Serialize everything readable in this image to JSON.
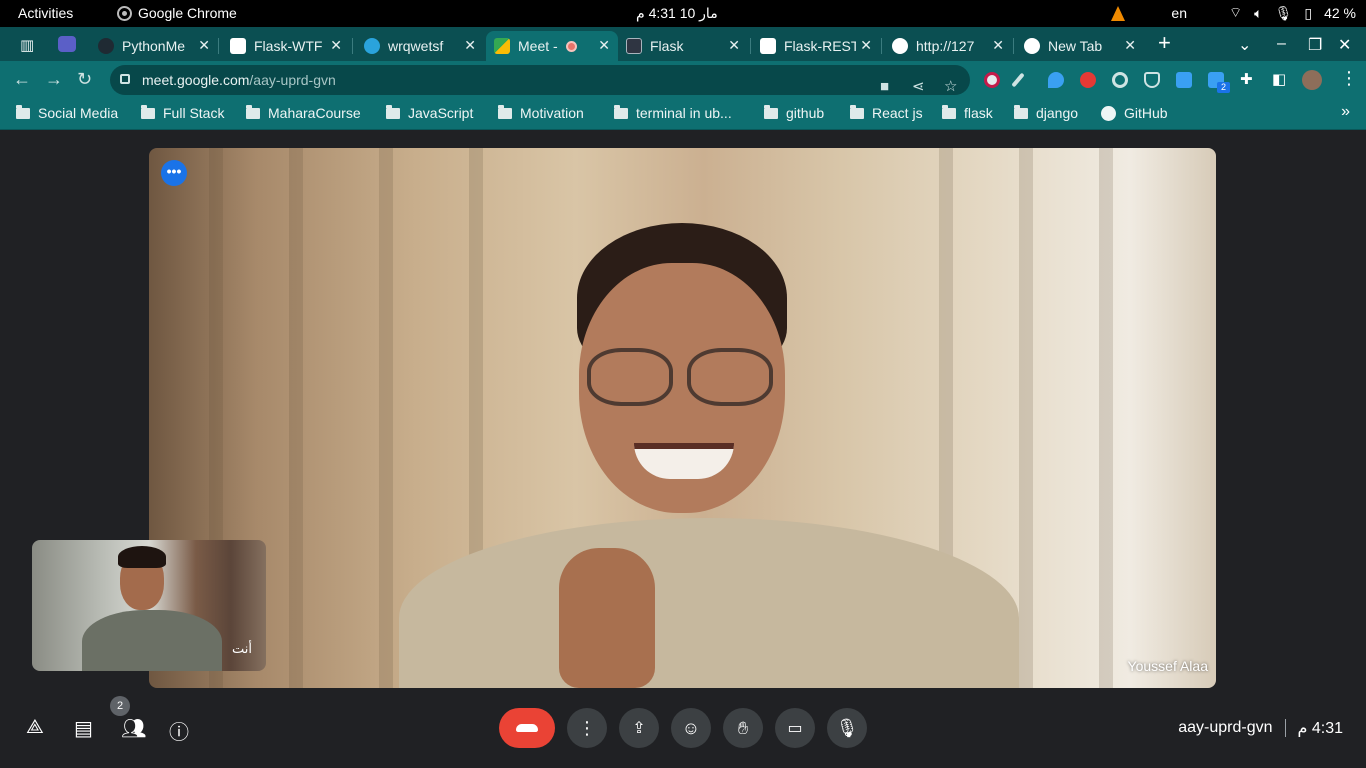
{
  "gnome": {
    "activities": "Activities",
    "app_name": "Google Chrome",
    "clock": "مار 10  4:31 م",
    "lang": "en",
    "battery": "42 %"
  },
  "tabs": [
    {
      "title": "PythonMe",
      "favicon_color": "#1f2a33"
    },
    {
      "title": "Flask-WTF",
      "favicon_color": "#ffffff"
    },
    {
      "title": "wrqwetsf",
      "favicon_color": "#2aa3dc"
    },
    {
      "title": "Meet -",
      "favicon_color": "#34a853",
      "active": true
    },
    {
      "title": "Flask",
      "favicon_color": "#2f3542"
    },
    {
      "title": "Flask-REST",
      "favicon_color": "#ffffff"
    },
    {
      "title": "http://127",
      "favicon_color": "#ffffff"
    },
    {
      "title": "New Tab",
      "favicon_color": "#ffffff"
    }
  ],
  "address_bar": {
    "host": "meet.google.com",
    "path": "/aay-uprd-gvn"
  },
  "bookmarks": [
    {
      "label": "Social Media"
    },
    {
      "label": "Full Stack"
    },
    {
      "label": "MaharaCourse"
    },
    {
      "label": "JavaScript"
    },
    {
      "label": "Motivation"
    },
    {
      "label": "terminal in ub..."
    },
    {
      "label": "github"
    },
    {
      "label": "React js"
    },
    {
      "label": "flask"
    },
    {
      "label": "django"
    },
    {
      "label": "GitHub"
    }
  ],
  "meet": {
    "participant_name": "Youssef Alaa",
    "self_label": "أنت",
    "people_count": "2",
    "meeting_code": "aay-uprd-gvn",
    "time": "4:31 م",
    "extension_badge": "2"
  },
  "colors": {
    "end_call": "#ea4335",
    "accent": "#1a73e8",
    "chrome_frame": "#0e6f71"
  }
}
